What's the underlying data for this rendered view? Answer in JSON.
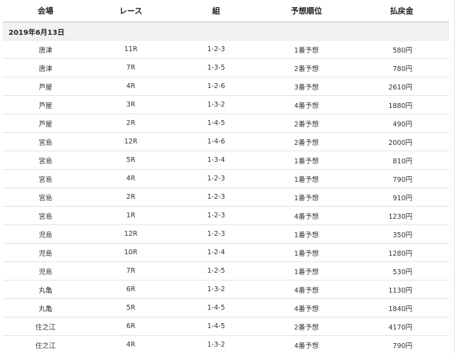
{
  "headers": [
    "会場",
    "レース",
    "組",
    "予想順位",
    "払戻金"
  ],
  "date": "2019年6月13日",
  "rows": [
    {
      "venue": "唐津",
      "race": "11R",
      "combo": "1-2-3",
      "rank": "1番予想",
      "payout": "580円"
    },
    {
      "venue": "唐津",
      "race": "7R",
      "combo": "1-3-5",
      "rank": "2番予想",
      "payout": "780円"
    },
    {
      "venue": "芦屋",
      "race": "4R",
      "combo": "1-2-6",
      "rank": "3番予想",
      "payout": "2610円"
    },
    {
      "venue": "芦屋",
      "race": "3R",
      "combo": "1-3-2",
      "rank": "4番予想",
      "payout": "1880円"
    },
    {
      "venue": "芦屋",
      "race": "2R",
      "combo": "1-4-5",
      "rank": "2番予想",
      "payout": "490円"
    },
    {
      "venue": "宮島",
      "race": "12R",
      "combo": "1-4-6",
      "rank": "2番予想",
      "payout": "2000円"
    },
    {
      "venue": "宮島",
      "race": "5R",
      "combo": "1-3-4",
      "rank": "1番予想",
      "payout": "810円"
    },
    {
      "venue": "宮島",
      "race": "4R",
      "combo": "1-2-3",
      "rank": "1番予想",
      "payout": "790円"
    },
    {
      "venue": "宮島",
      "race": "2R",
      "combo": "1-2-3",
      "rank": "1番予想",
      "payout": "910円"
    },
    {
      "venue": "宮島",
      "race": "1R",
      "combo": "1-2-3",
      "rank": "4番予想",
      "payout": "1230円"
    },
    {
      "venue": "児島",
      "race": "12R",
      "combo": "1-2-3",
      "rank": "1番予想",
      "payout": "350円"
    },
    {
      "venue": "児島",
      "race": "10R",
      "combo": "1-2-4",
      "rank": "1番予想",
      "payout": "1280円"
    },
    {
      "venue": "児島",
      "race": "7R",
      "combo": "1-2-5",
      "rank": "1番予想",
      "payout": "530円"
    },
    {
      "venue": "丸亀",
      "race": "6R",
      "combo": "1-3-2",
      "rank": "4番予想",
      "payout": "1130円"
    },
    {
      "venue": "丸亀",
      "race": "5R",
      "combo": "1-4-5",
      "rank": "4番予想",
      "payout": "1840円"
    },
    {
      "venue": "住之江",
      "race": "6R",
      "combo": "1-4-5",
      "rank": "2番予想",
      "payout": "4170円"
    },
    {
      "venue": "住之江",
      "race": "4R",
      "combo": "1-3-2",
      "rank": "4番予想",
      "payout": "790円"
    }
  ],
  "colors": {
    "rank_link": "#2f6fd8",
    "date_row_bg": "#f2f2f2",
    "border": "#e3e3e3"
  }
}
